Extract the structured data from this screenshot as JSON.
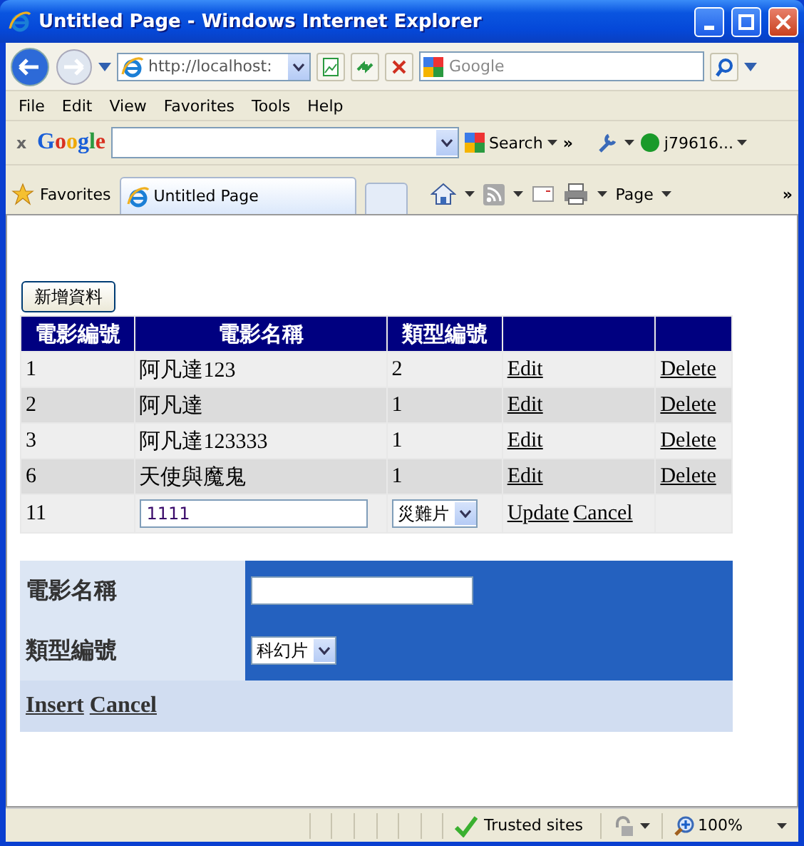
{
  "window": {
    "title": "Untitled Page - Windows Internet Explorer"
  },
  "address_bar": {
    "value": "http://localhost:"
  },
  "search_box": {
    "placeholder": "Google"
  },
  "menu": [
    "File",
    "Edit",
    "View",
    "Favorites",
    "Tools",
    "Help"
  ],
  "google_toolbar": {
    "close": "x",
    "logo": "Google",
    "search_button": "Search",
    "chevron": "»",
    "account": "j79616..."
  },
  "favorites_bar": {
    "favorites": "Favorites",
    "tab": "Untitled Page",
    "page_menu": "Page",
    "chevron": "»"
  },
  "page": {
    "add_button": "新增資料",
    "grid": {
      "columns": [
        "電影編號",
        "電影名稱",
        "類型編號"
      ],
      "rows": [
        {
          "kind": "view",
          "id": "1",
          "name": "阿凡達123",
          "type": "2",
          "actions": [
            "Edit",
            "Delete"
          ]
        },
        {
          "kind": "view",
          "id": "2",
          "name": "阿凡達",
          "type": "1",
          "actions": [
            "Edit",
            "Delete"
          ]
        },
        {
          "kind": "view",
          "id": "3",
          "name": "阿凡達123333",
          "type": "1",
          "actions": [
            "Edit",
            "Delete"
          ]
        },
        {
          "kind": "view",
          "id": "6",
          "name": "天使與魔鬼",
          "type": "1",
          "actions": [
            "Edit",
            "Delete"
          ]
        },
        {
          "kind": "edit",
          "id": "11",
          "name": "1111",
          "type": "災難片",
          "actions": [
            "Update",
            "Cancel"
          ]
        }
      ]
    },
    "form": {
      "fields": [
        {
          "label": "電影名稱",
          "kind": "text"
        },
        {
          "label": "類型編號",
          "kind": "select",
          "value": "科幻片"
        }
      ],
      "actions": [
        "Insert",
        "Cancel"
      ]
    }
  },
  "status_bar": {
    "zone": "Trusted sites",
    "zoom": "100%"
  }
}
